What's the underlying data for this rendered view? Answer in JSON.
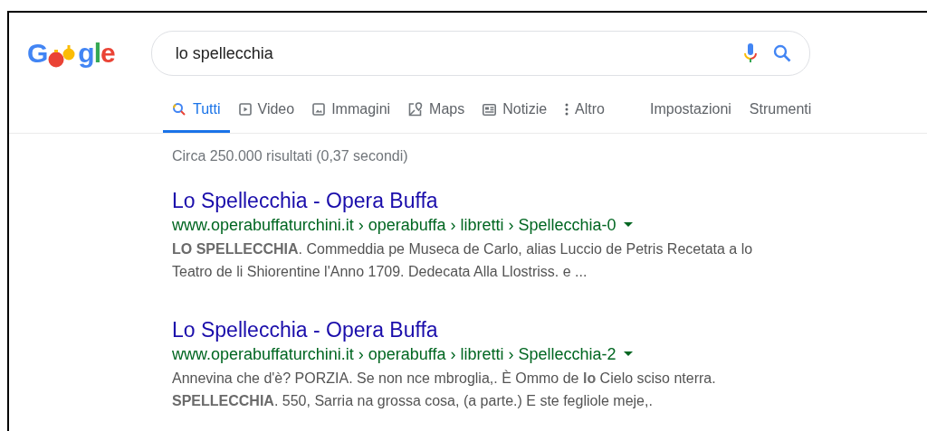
{
  "logo": {
    "start": "G",
    "end": "gle"
  },
  "search": {
    "value": "lo spellecchia"
  },
  "tabs": [
    {
      "label": "Tutti",
      "kind": "search",
      "selected": true
    },
    {
      "label": "Video",
      "kind": "video",
      "selected": false
    },
    {
      "label": "Immagini",
      "kind": "image",
      "selected": false
    },
    {
      "label": "Maps",
      "kind": "map",
      "selected": false
    },
    {
      "label": "Notizie",
      "kind": "news",
      "selected": false
    },
    {
      "label": "Altro",
      "kind": "more",
      "selected": false
    }
  ],
  "tools": [
    "Impostazioni",
    "Strumenti"
  ],
  "stats": "Circa 250.000 risultati (0,37 secondi)",
  "results": [
    {
      "title": "Lo Spellecchia - Opera Buffa",
      "url": "www.operabuffaturchini.it › operabuffa › libretti › Spellecchia-0",
      "snippet": "**LO SPELLECCHIA**. Commeddia pe Museca de Carlo, alias Luccio de Petris Recetata a lo Teatro de li Shiorentine l'Anno 1709. Dedecata Alla Llostriss. e ..."
    },
    {
      "title": "Lo Spellecchia - Opera Buffa",
      "url": "www.operabuffaturchini.it › operabuffa › libretti › Spellecchia-2",
      "snippet": "Annevina che d'è? PORZIA. Se non nce mbroglia,. È Ommo de **lo** Cielo sciso nterra. **SPELLECCHIA**. 550, Sarria na grossa cosa, (a parte.) E ste fegliole meje,."
    }
  ]
}
